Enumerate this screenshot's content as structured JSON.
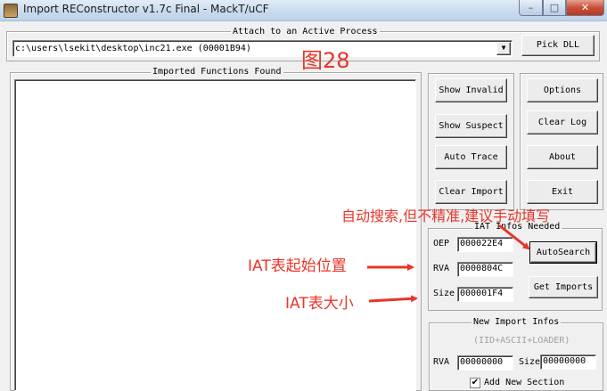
{
  "window": {
    "title": "Import REConstructor v1.7c Final - MackT/uCF",
    "minimize_icon": "minimize-icon",
    "maximize_icon": "maximize-icon",
    "close_icon": "close-icon"
  },
  "attach": {
    "group_label": "Attach to an Active Process",
    "process_value": "c:\\users\\lsekit\\desktop\\inc21.exe (00001B94)",
    "pick_dll": "Pick DLL"
  },
  "imports": {
    "group_label": "Imported Functions Found"
  },
  "buttons": {
    "show_invalid": "Show Invalid",
    "show_suspect": "Show Suspect",
    "auto_trace": "Auto Trace",
    "clear_import": "Clear Import",
    "options": "Options",
    "clear_log": "Clear Log",
    "about": "About",
    "exit": "Exit"
  },
  "iat": {
    "group_label": "IAT Infos Needed",
    "oep_label": "OEP",
    "oep_value": "000022E4",
    "rva_label": "RVA",
    "rva_value": "0000804C",
    "size_label": "Size",
    "size_value": "000001F4",
    "autosearch": "AutoSearch",
    "get_imports": "Get Imports"
  },
  "new_import": {
    "group_label": "New Import Infos",
    "subtitle": "(IID+ASCII+LOADER)",
    "rva_label": "RVA",
    "rva_value": "00000000",
    "size_label": "Size",
    "size_value": "00000000",
    "add_section_label": "Add New Section",
    "add_section_checked": true
  },
  "annotations": {
    "figure": "图28",
    "autosearch_note": "自动搜索,但不精准,建议手动填写",
    "iat_start_note": "IAT表起始位置",
    "iat_size_note": "IAT表大小",
    "color": "#e8352a"
  }
}
